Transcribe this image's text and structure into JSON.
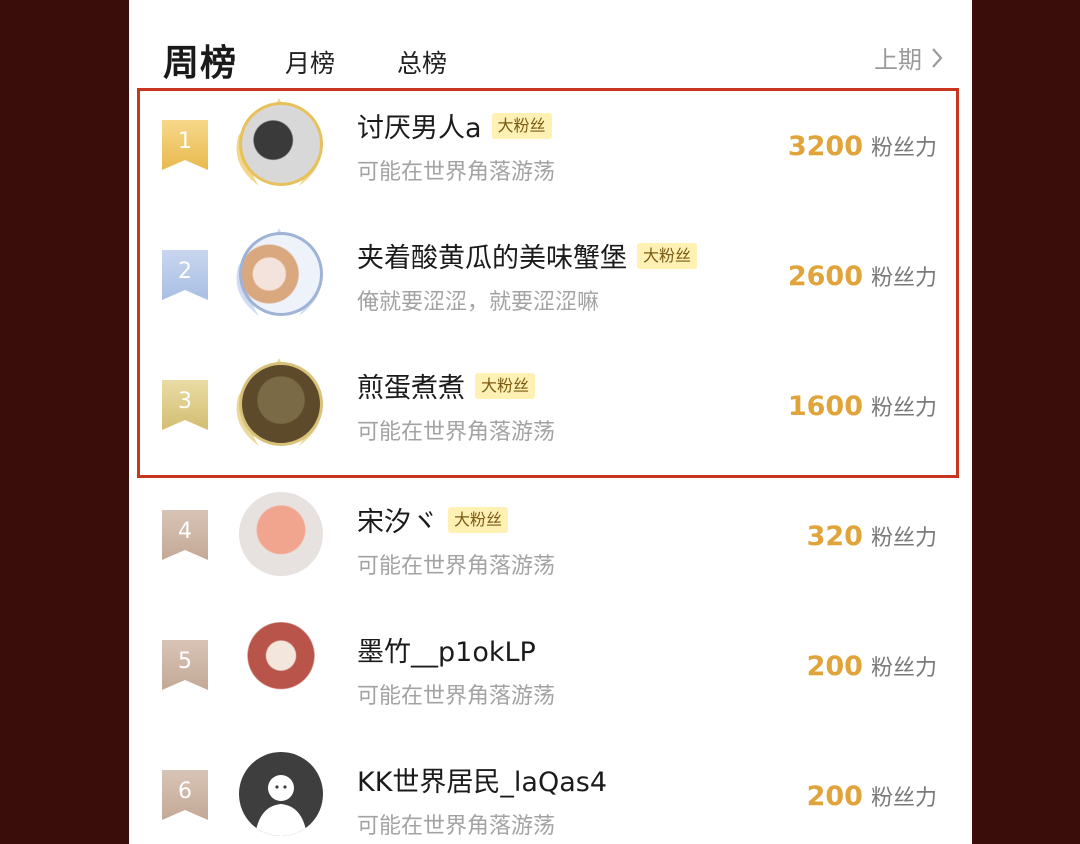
{
  "tabs": {
    "week": "周榜",
    "month": "月榜",
    "total": "总榜",
    "prev": "上期"
  },
  "rows": [
    {
      "rank": "1",
      "name": "讨厌男人a",
      "tag": "大粉丝",
      "sub": "可能在世界角落游荡",
      "score": "3200",
      "unit": "粉丝力"
    },
    {
      "rank": "2",
      "name": "夹着酸黄瓜的美味蟹堡",
      "tag": "大粉丝",
      "sub": "俺就要涩涩，就要涩涩嘛",
      "score": "2600",
      "unit": "粉丝力"
    },
    {
      "rank": "3",
      "name": "煎蛋煮煮",
      "tag": "大粉丝",
      "sub": "可能在世界角落游荡",
      "score": "1600",
      "unit": "粉丝力"
    },
    {
      "rank": "4",
      "name": "宋汐ヾ",
      "tag": "大粉丝",
      "sub": "可能在世界角落游荡",
      "score": "320",
      "unit": "粉丝力"
    },
    {
      "rank": "5",
      "name": "墨竹__p1okLP",
      "tag": "",
      "sub": "可能在世界角落游荡",
      "score": "200",
      "unit": "粉丝力"
    },
    {
      "rank": "6",
      "name": "KK世界居民_laQas4",
      "tag": "",
      "sub": "可能在世界角落游荡",
      "score": "200",
      "unit": "粉丝力"
    }
  ],
  "colors": {
    "accent": "#e0a43a",
    "highlight_border": "#c8361f",
    "backdrop": "#3a0d0b"
  }
}
